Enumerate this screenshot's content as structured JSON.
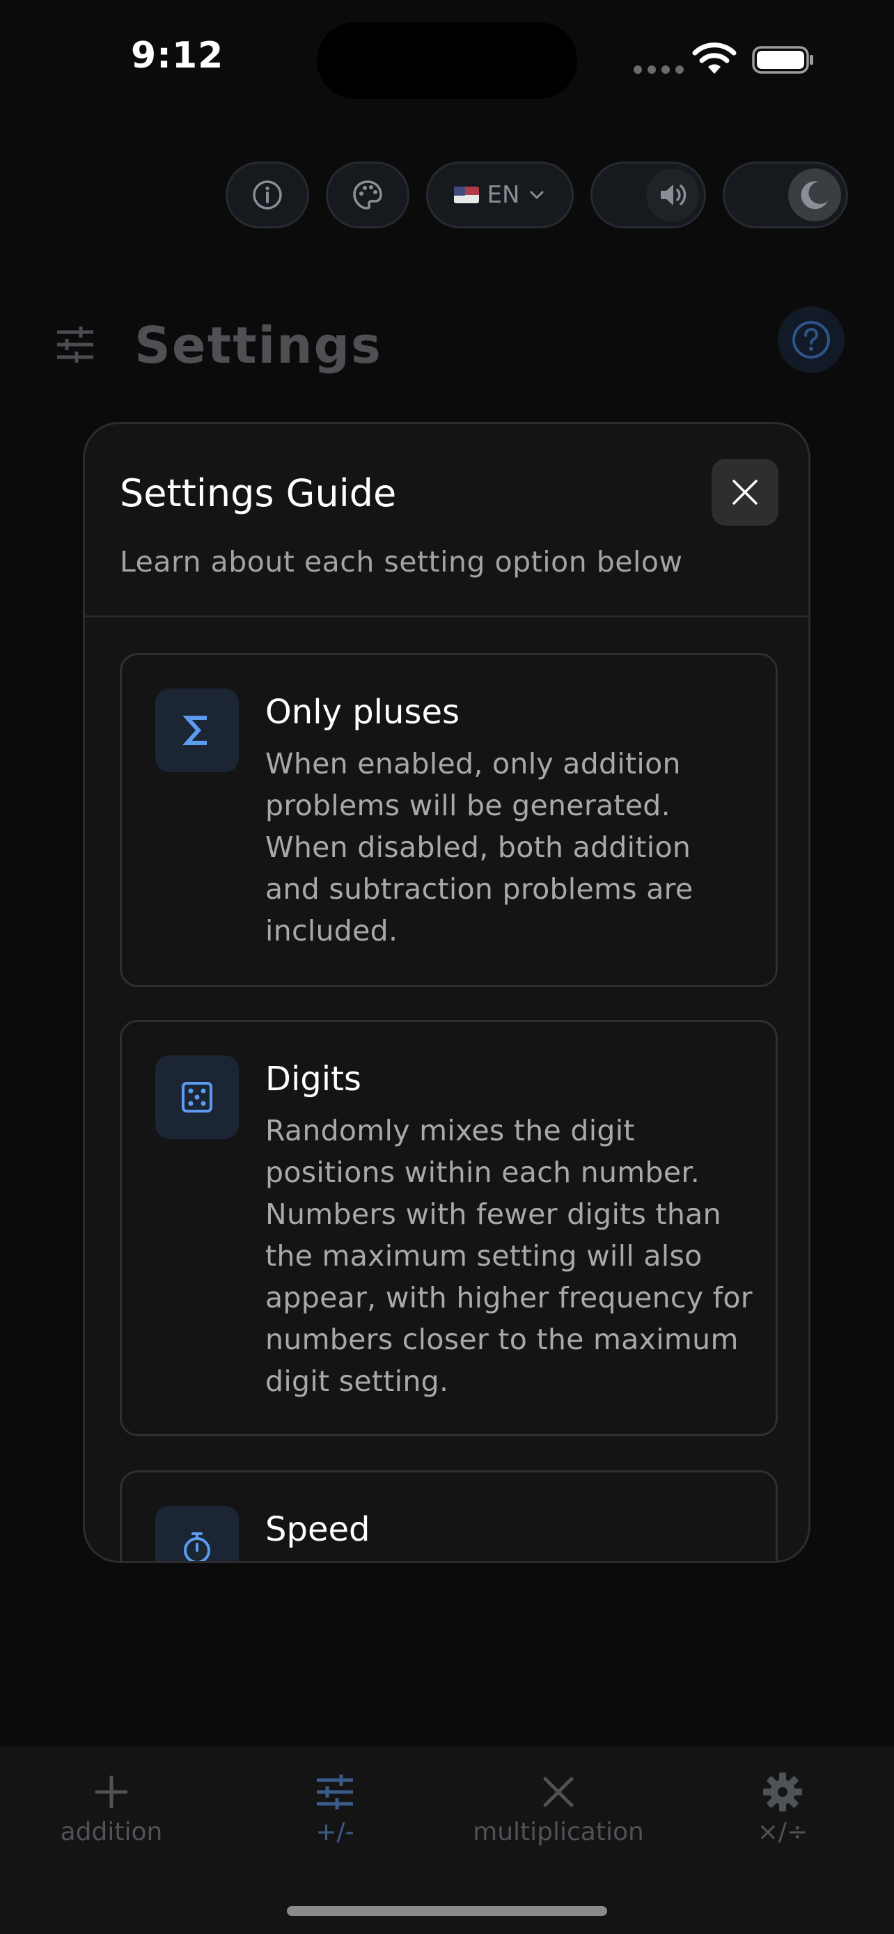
{
  "status_bar": {
    "time": "9:12"
  },
  "top_controls": {
    "language_code": "EN"
  },
  "header": {
    "title": "Settings"
  },
  "modal": {
    "title": "Settings Guide",
    "subtitle": "Learn about each setting option below",
    "items": [
      {
        "icon": "sigma-icon",
        "title": "Only pluses",
        "description": "When enabled, only addition problems will be generated. When disabled, both addition and subtraction problems are included."
      },
      {
        "icon": "dice-icon",
        "title": "Digits",
        "description": "Randomly mixes the digit positions within each number. Numbers with fewer digits than the maximum setting will also appear, with higher frequency for numbers closer to the maximum digit setting."
      },
      {
        "icon": "stopwatch-icon",
        "title": "Speed",
        "description": ""
      }
    ]
  },
  "tabbar": {
    "tabs": [
      {
        "label": "addition",
        "icon": "plus-icon",
        "active": false
      },
      {
        "label": "+/-",
        "icon": "sliders-icon",
        "active": true
      },
      {
        "label": "multiplication",
        "icon": "times-icon",
        "active": false
      },
      {
        "label": "×/÷",
        "icon": "gear-icon",
        "active": false
      }
    ]
  },
  "colors": {
    "background": "#0b0b0c",
    "modal_background": "#141414",
    "accent_blue": "#5b9cf0",
    "active_tab": "#3a5c8a"
  }
}
